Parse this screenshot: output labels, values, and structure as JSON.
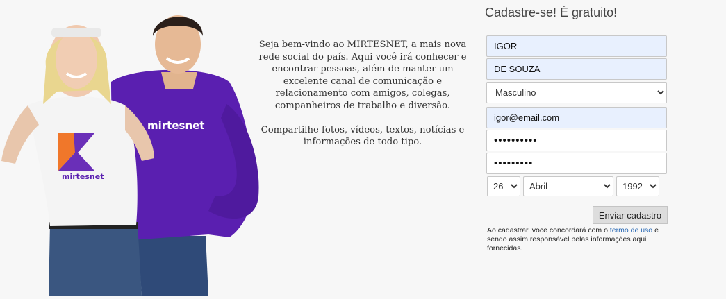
{
  "hero": {
    "shirt_brand_front": "mirtesnet",
    "shirt_brand_back": "mirtesnet"
  },
  "welcome": {
    "paragraph1": "Seja bem-vindo ao MIRTESNET, a  mais nova rede social do país. Aqui você irá conhecer e encontrar  pessoas, além de manter um  excelente canal de comunicação e  relacionamento com amigos,  colegas, companheiros de trabalho e  diversão.",
    "paragraph2": "Compartilhe fotos, vídeos, textos, notícias e informações de todo tipo."
  },
  "register": {
    "title": "Cadastre-se! É gratuito!",
    "first_name": "IGOR",
    "last_name": "DE SOUZA",
    "gender": "Masculino",
    "email": "igor@email.com",
    "password_mask": "••••••••••",
    "password_confirm_mask": "•••••••••",
    "birth_day": "26",
    "birth_month": "Abril",
    "birth_year": "1992",
    "submit_label": "Enviar cadastro",
    "terms_prefix": "Ao cadastrar, voce concordará com o",
    "terms_link": "termo de uso",
    "terms_suffix": "e sendo assim responsável pelas informações aqui fornecidas."
  },
  "colors": {
    "purple_shirt": "#5a1fb0",
    "autofill_bg": "#e8f0fe",
    "link": "#2a6ab5"
  }
}
